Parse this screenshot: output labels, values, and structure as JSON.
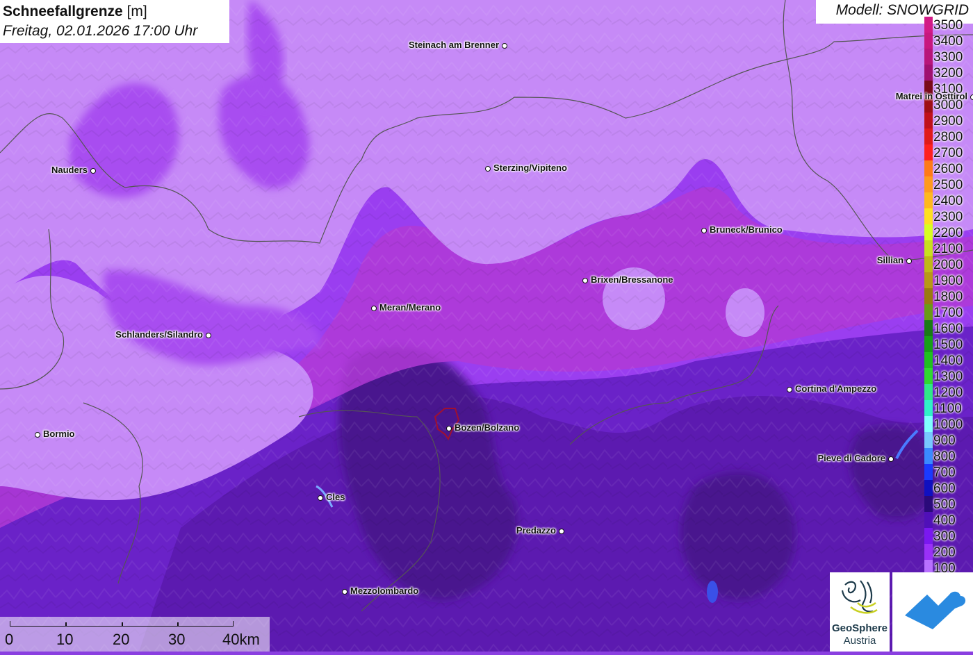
{
  "header": {
    "title": "Schneefallgrenze",
    "unit": "[m]",
    "datetime": "Freitag, 02.01.2026 17:00 Uhr",
    "model": "Modell: SNOWGRID"
  },
  "legend": {
    "entries": [
      {
        "label": "3500",
        "color": "#d21a86"
      },
      {
        "label": "3400",
        "color": "#c8177f"
      },
      {
        "label": "3300",
        "color": "#b8157a"
      },
      {
        "label": "3200",
        "color": "#a01070"
      },
      {
        "label": "3100",
        "color": "#7a0a1a"
      },
      {
        "label": "3000",
        "color": "#9e0f16"
      },
      {
        "label": "2900",
        "color": "#c0101c"
      },
      {
        "label": "2800",
        "color": "#e01a1a"
      },
      {
        "label": "2700",
        "color": "#ff2020"
      },
      {
        "label": "2600",
        "color": "#ff7a18"
      },
      {
        "label": "2500",
        "color": "#ff9a1e"
      },
      {
        "label": "2400",
        "color": "#ffb81e"
      },
      {
        "label": "2300",
        "color": "#ffe020"
      },
      {
        "label": "2200",
        "color": "#d8ff20"
      },
      {
        "label": "2100",
        "color": "#c8e020"
      },
      {
        "label": "2000",
        "color": "#c0b818"
      },
      {
        "label": "1900",
        "color": "#b89818"
      },
      {
        "label": "1800",
        "color": "#9a7a10"
      },
      {
        "label": "1700",
        "color": "#6a9a18"
      },
      {
        "label": "1600",
        "color": "#1a7a18"
      },
      {
        "label": "1500",
        "color": "#18a018"
      },
      {
        "label": "1400",
        "color": "#20c020"
      },
      {
        "label": "1300",
        "color": "#30d830"
      },
      {
        "label": "1200",
        "color": "#30e888"
      },
      {
        "label": "1100",
        "color": "#30f0c8"
      },
      {
        "label": "1000",
        "color": "#80ffff"
      },
      {
        "label": "900",
        "color": "#78c8ff"
      },
      {
        "label": "800",
        "color": "#3a8aff"
      },
      {
        "label": "700",
        "color": "#1a3aff"
      },
      {
        "label": "600",
        "color": "#1010c0"
      },
      {
        "label": "500",
        "color": "#2a0a7a"
      },
      {
        "label": "400",
        "color": "#5010b8"
      },
      {
        "label": "300",
        "color": "#7a18f0"
      },
      {
        "label": "200",
        "color": "#9a30f8"
      },
      {
        "label": "100",
        "color": "#b870ff"
      }
    ]
  },
  "cities": [
    {
      "name": "Steinach am Brenner",
      "label_side": "left"
    },
    {
      "name": "Nauders",
      "label_side": "left"
    },
    {
      "name": "Sterzing/Vipiteno",
      "label_side": "right"
    },
    {
      "name": "Matrei in Osttirol",
      "label_side": "left"
    },
    {
      "name": "Bruneck/Brunico",
      "label_side": "right"
    },
    {
      "name": "Sillian",
      "label_side": "left"
    },
    {
      "name": "Brixen/Bressanone",
      "label_side": "right"
    },
    {
      "name": "Meran/Merano",
      "label_side": "right"
    },
    {
      "name": "Schlanders/Silandro",
      "label_side": "left"
    },
    {
      "name": "Cortina d'Ampezzo",
      "label_side": "right"
    },
    {
      "name": "Bormio",
      "label_side": "right"
    },
    {
      "name": "Bozen/Bolzano",
      "label_side": "right"
    },
    {
      "name": "Pieve di Cadore",
      "label_side": "left"
    },
    {
      "name": "Cles",
      "label_side": "right"
    },
    {
      "name": "Predazzo",
      "label_side": "left"
    },
    {
      "name": "Mezzolombardo",
      "label_side": "right"
    }
  ],
  "scale": {
    "labels": [
      "0",
      "10",
      "20",
      "30",
      "40km"
    ]
  },
  "logos": {
    "geosphere_line1": "GeoSphere",
    "geosphere_line2": "Austria",
    "geosphere_icon": "geosphere-logo-icon",
    "second_icon": "cloud-arrow-logo-icon"
  }
}
